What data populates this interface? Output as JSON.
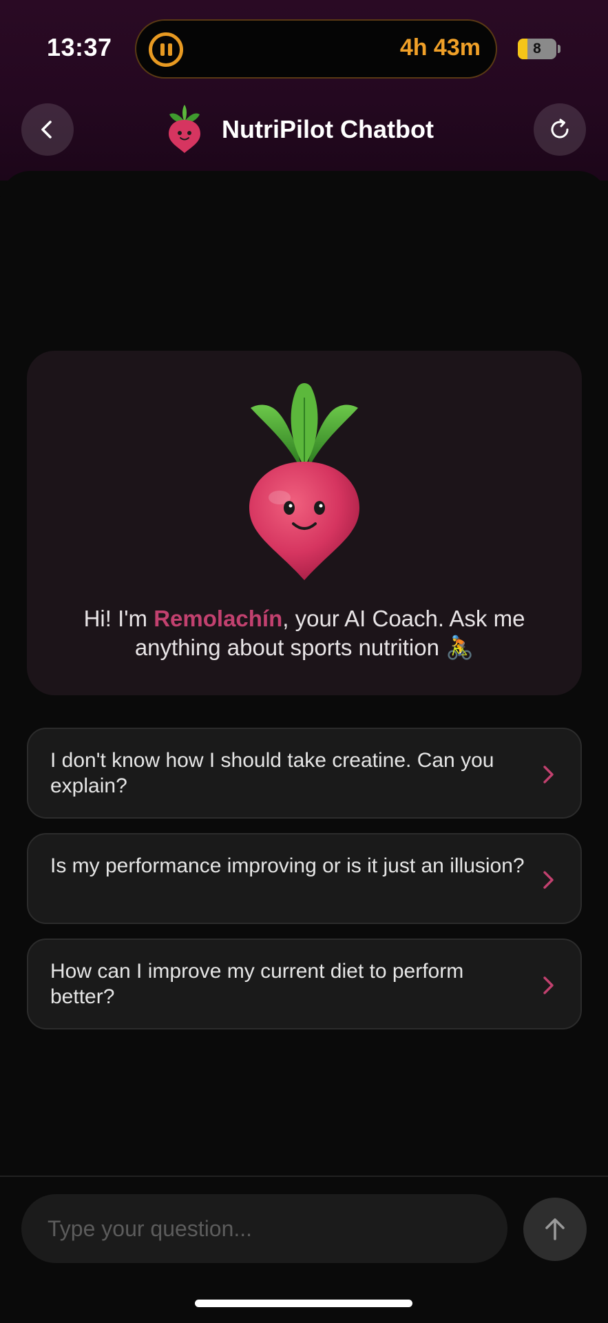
{
  "status_bar": {
    "time": "13:37",
    "activity_timer": "4h 43m",
    "battery_level": "8"
  },
  "header": {
    "title": "NutriPilot Chatbot",
    "back_icon": "chevron-left-icon",
    "refresh_icon": "refresh-icon",
    "logo_icon": "beet-icon"
  },
  "intro": {
    "greeting_prefix": "Hi! I'm ",
    "bot_name": "Remolachín",
    "greeting_suffix": ", your AI Coach. Ask me anything about sports nutrition 🚴"
  },
  "suggestions": [
    {
      "text": "I don't know how I should take creatine. Can you explain?"
    },
    {
      "text": "Is my performance improving or is it just an illusion?"
    },
    {
      "text": "How can I improve my current diet to perform better?"
    }
  ],
  "composer": {
    "placeholder": "Type your question...",
    "send_icon": "arrow-up-icon"
  },
  "colors": {
    "accent": "#c2416f",
    "header_bg": "#2a0a24",
    "timer": "#f0a028"
  }
}
